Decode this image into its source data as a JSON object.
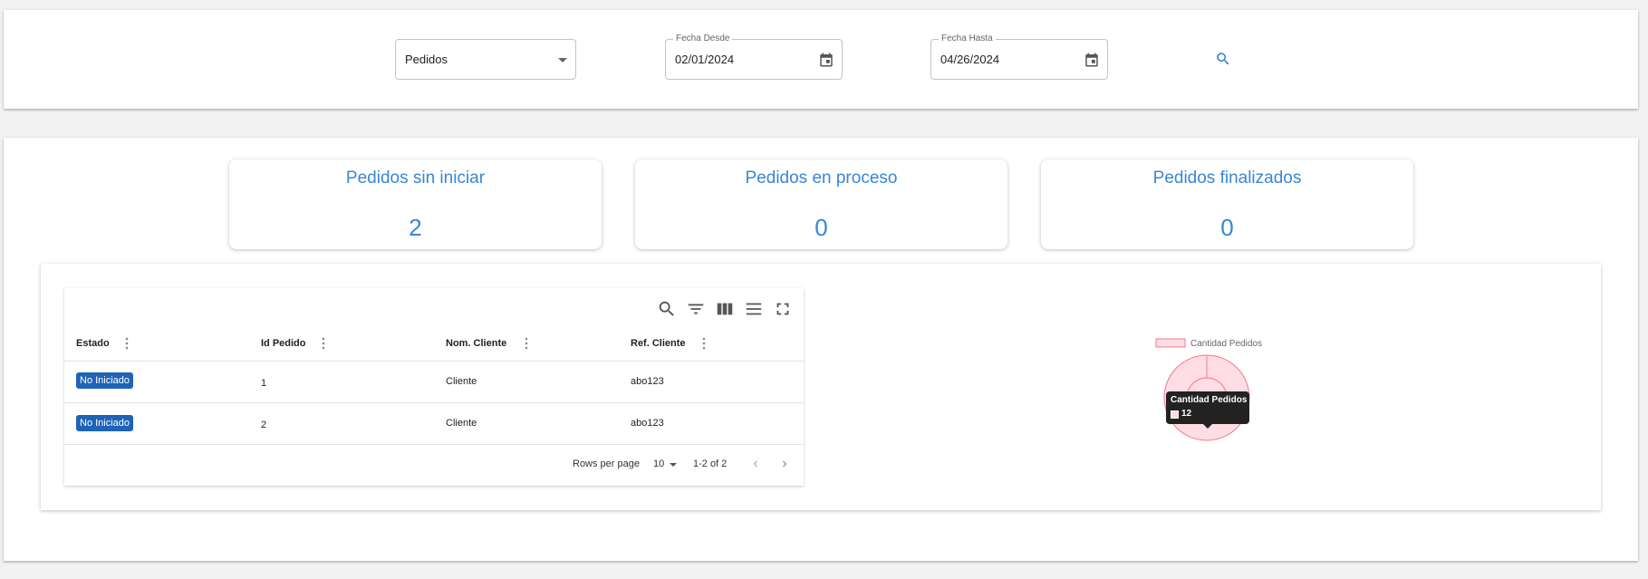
{
  "filters": {
    "entity_select": {
      "value": "Pedidos"
    },
    "date_from": {
      "label": "Fecha Desde",
      "value": "02/01/2024"
    },
    "date_to": {
      "label": "Fecha Hasta",
      "value": "04/26/2024"
    }
  },
  "kpis": [
    {
      "title": "Pedidos sin iniciar",
      "value": "2"
    },
    {
      "title": "Pedidos en proceso",
      "value": "0"
    },
    {
      "title": "Pedidos finalizados",
      "value": "0"
    }
  ],
  "table": {
    "columns": [
      "Estado",
      "Id Pedido",
      "Nom. Cliente",
      "Ref. Cliente"
    ],
    "rows": [
      {
        "estado": "No Iniciado",
        "id": "1",
        "cliente": "Cliente",
        "ref": "abo123"
      },
      {
        "estado": "No Iniciado",
        "id": "2",
        "cliente": "Cliente",
        "ref": "abo123"
      }
    ],
    "pagination": {
      "rows_per_page_label": "Rows per page",
      "rows_per_page": "10",
      "range": "1-2 of 2"
    }
  },
  "chart_data": {
    "type": "pie",
    "legend": [
      "Cantidad Pedidos"
    ],
    "series": [
      {
        "name": "Cantidad Pedidos",
        "values": [
          12
        ]
      }
    ],
    "tooltip": {
      "title": "Cantidad Pedidos",
      "value": "12"
    },
    "colors": {
      "fill": "#ffdde4",
      "stroke": "#f07a93"
    }
  },
  "colors": {
    "accent": "#3a86d4",
    "badge": "#1e63b8"
  }
}
